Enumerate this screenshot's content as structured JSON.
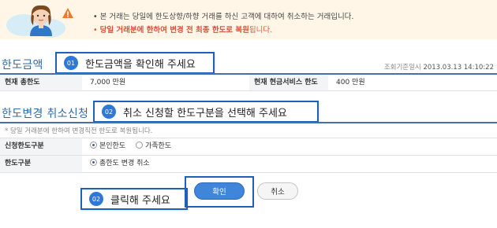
{
  "notice": {
    "line1": "• 본 거래는 당일에 한도상향/하향 거래를 하신 고객에 대하여 취소하는 거래입니다.",
    "line2_prefix": "• ",
    "line2_emph": "당일 거래분에 한하여 변경 전 최종 한도로 복원",
    "line2_suffix": "됩니다.",
    "icons": [
      "mascot-icon",
      "warning-icon"
    ]
  },
  "limit_section": {
    "title": "한도금액",
    "callout": {
      "badge": "01",
      "text": "한도금액을 확인해 주세요"
    },
    "meta_label": "조회기준일시",
    "meta_value": "2013.03.13 14:10:22",
    "rows": {
      "total_label": "현재 총한도",
      "total_value": "7,000 만원",
      "cash_label": "현재 현금서비스 한도",
      "cash_value": "400 만원"
    }
  },
  "cancel_section": {
    "title": "한도변경 취소신청",
    "callout": {
      "badge": "02",
      "text": "취소 신청할 한도구분을 선택해 주세요"
    },
    "hint": "* 당일 거래분에 한하여 변경직전 한도로 복원됩니다.",
    "applicant_label": "신청한도구분",
    "applicant_options": [
      {
        "label": "본인한도",
        "selected": true
      },
      {
        "label": "가족한도",
        "selected": false
      }
    ],
    "type_label": "한도구분",
    "type_options": [
      {
        "label": "총한도 변경 취소",
        "selected": true
      }
    ]
  },
  "actions": {
    "callout": {
      "badge": "02",
      "text": "클릭해 주세요"
    },
    "confirm_label": "확인",
    "cancel_label": "취소"
  },
  "colors": {
    "accent": "#2f6aa8",
    "callout_border": "#1f5fb8",
    "emphasis": "#e0503a",
    "notice_bg": "#fff6e8"
  }
}
